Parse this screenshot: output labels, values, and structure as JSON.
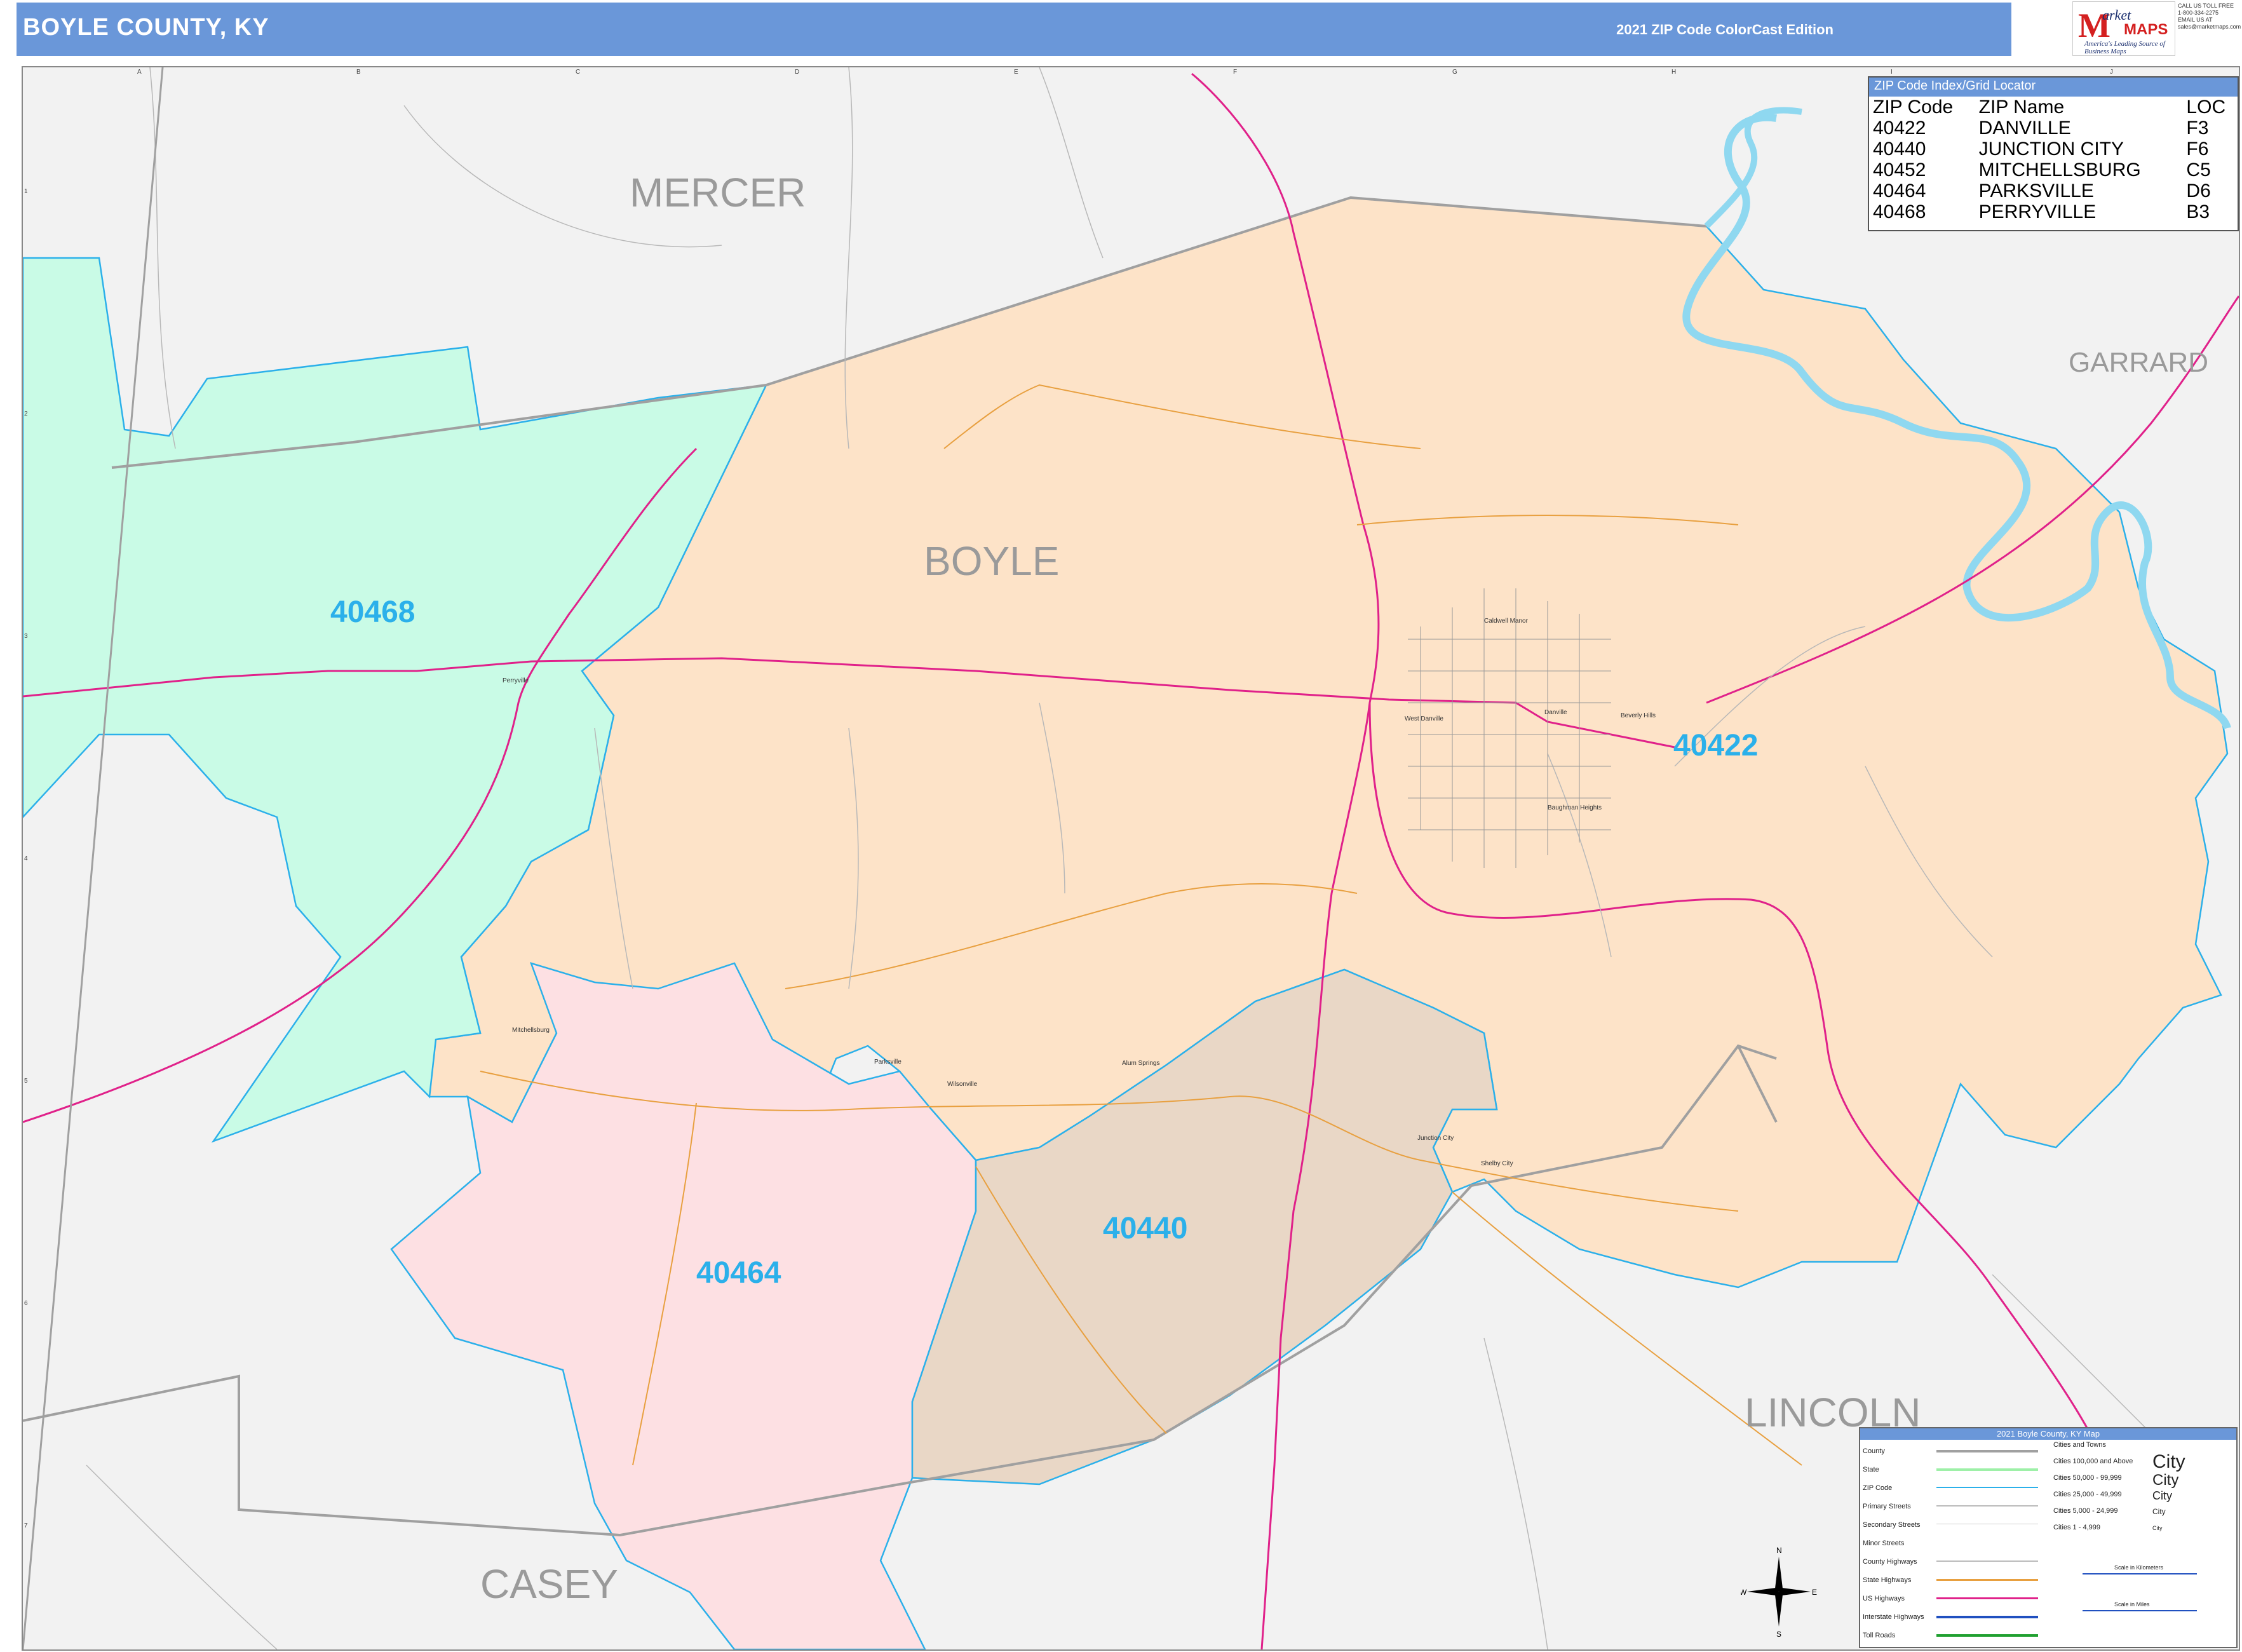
{
  "header": {
    "title": "BOYLE COUNTY, KY",
    "edition": "2021 ZIP Code ColorCast Edition",
    "logo_text_m": "M",
    "logo_text_market": "arket",
    "logo_text_maps": "MAPS",
    "logo_tagline": "America's Leading Source of Business Maps",
    "contact": [
      "CALL US TOLL FREE",
      "1-800-334-2275",
      "EMAIL US AT",
      "sales@marketmaps.com"
    ]
  },
  "map": {
    "counties": [
      "MERCER",
      "BOYLE",
      "GARRARD",
      "LINCOLN",
      "CASEY"
    ],
    "zip_labels": [
      "40468",
      "40422",
      "40440",
      "40464"
    ],
    "places": [
      "Perryville",
      "Danville",
      "West Danville",
      "Caldwell Manor",
      "Beverly Hills",
      "Baughman Heights",
      "Mitchellsburg",
      "Parksville",
      "Wilsonville",
      "Alum Springs",
      "Junction City",
      "Shelby City"
    ],
    "grid_columns": [
      "A",
      "B",
      "C",
      "D",
      "E",
      "F",
      "G",
      "H",
      "I",
      "J"
    ],
    "grid_rows": [
      "1",
      "2",
      "3",
      "4",
      "5",
      "6",
      "7"
    ],
    "zone_colors": {
      "40468": "#c9fbe6",
      "40422": "#fde3c8",
      "40440": "#e9d7c6",
      "40464": "#fde0e3",
      "outside": "#f2f2f2",
      "zip_boundary": "#2bb0ea",
      "us_highway": "#e0218a",
      "state_highway": "#e8a040",
      "river": "#8fd8f0"
    }
  },
  "zip_index": {
    "title": "ZIP Code Index/Grid Locator",
    "columns": [
      "ZIP Code",
      "ZIP Name",
      "LOC"
    ],
    "rows": [
      [
        "40422",
        "DANVILLE",
        "F3"
      ],
      [
        "40440",
        "JUNCTION CITY",
        "F6"
      ],
      [
        "40452",
        "MITCHELLSBURG",
        "C5"
      ],
      [
        "40464",
        "PARKSVILLE",
        "D6"
      ],
      [
        "40468",
        "PERRYVILLE",
        "B3"
      ]
    ]
  },
  "legend": {
    "title": "2021 Boyle County, KY Map",
    "items": [
      "County",
      "State",
      "ZIP Code",
      "Primary Streets",
      "Secondary Streets",
      "Minor Streets",
      "County Highways",
      "State Highways",
      "US Highways",
      "Interstate Highways",
      "Toll Roads"
    ],
    "cities_title": "Cities and Towns",
    "cities": [
      {
        "range": "Cities 100,000 and Above",
        "sample": "City"
      },
      {
        "range": "Cities 50,000 - 99,999",
        "sample": "City"
      },
      {
        "range": "Cities 25,000 - 49,999",
        "sample": "City"
      },
      {
        "range": "Cities 5,000 - 24,999",
        "sample": "City"
      },
      {
        "range": "Cities 1 - 4,999",
        "sample": "City"
      }
    ],
    "scale_km": "Scale in Kilometers",
    "scale_mi": "Scale in Miles"
  },
  "compass": {
    "n": "N",
    "s": "S",
    "e": "E",
    "w": "W"
  }
}
